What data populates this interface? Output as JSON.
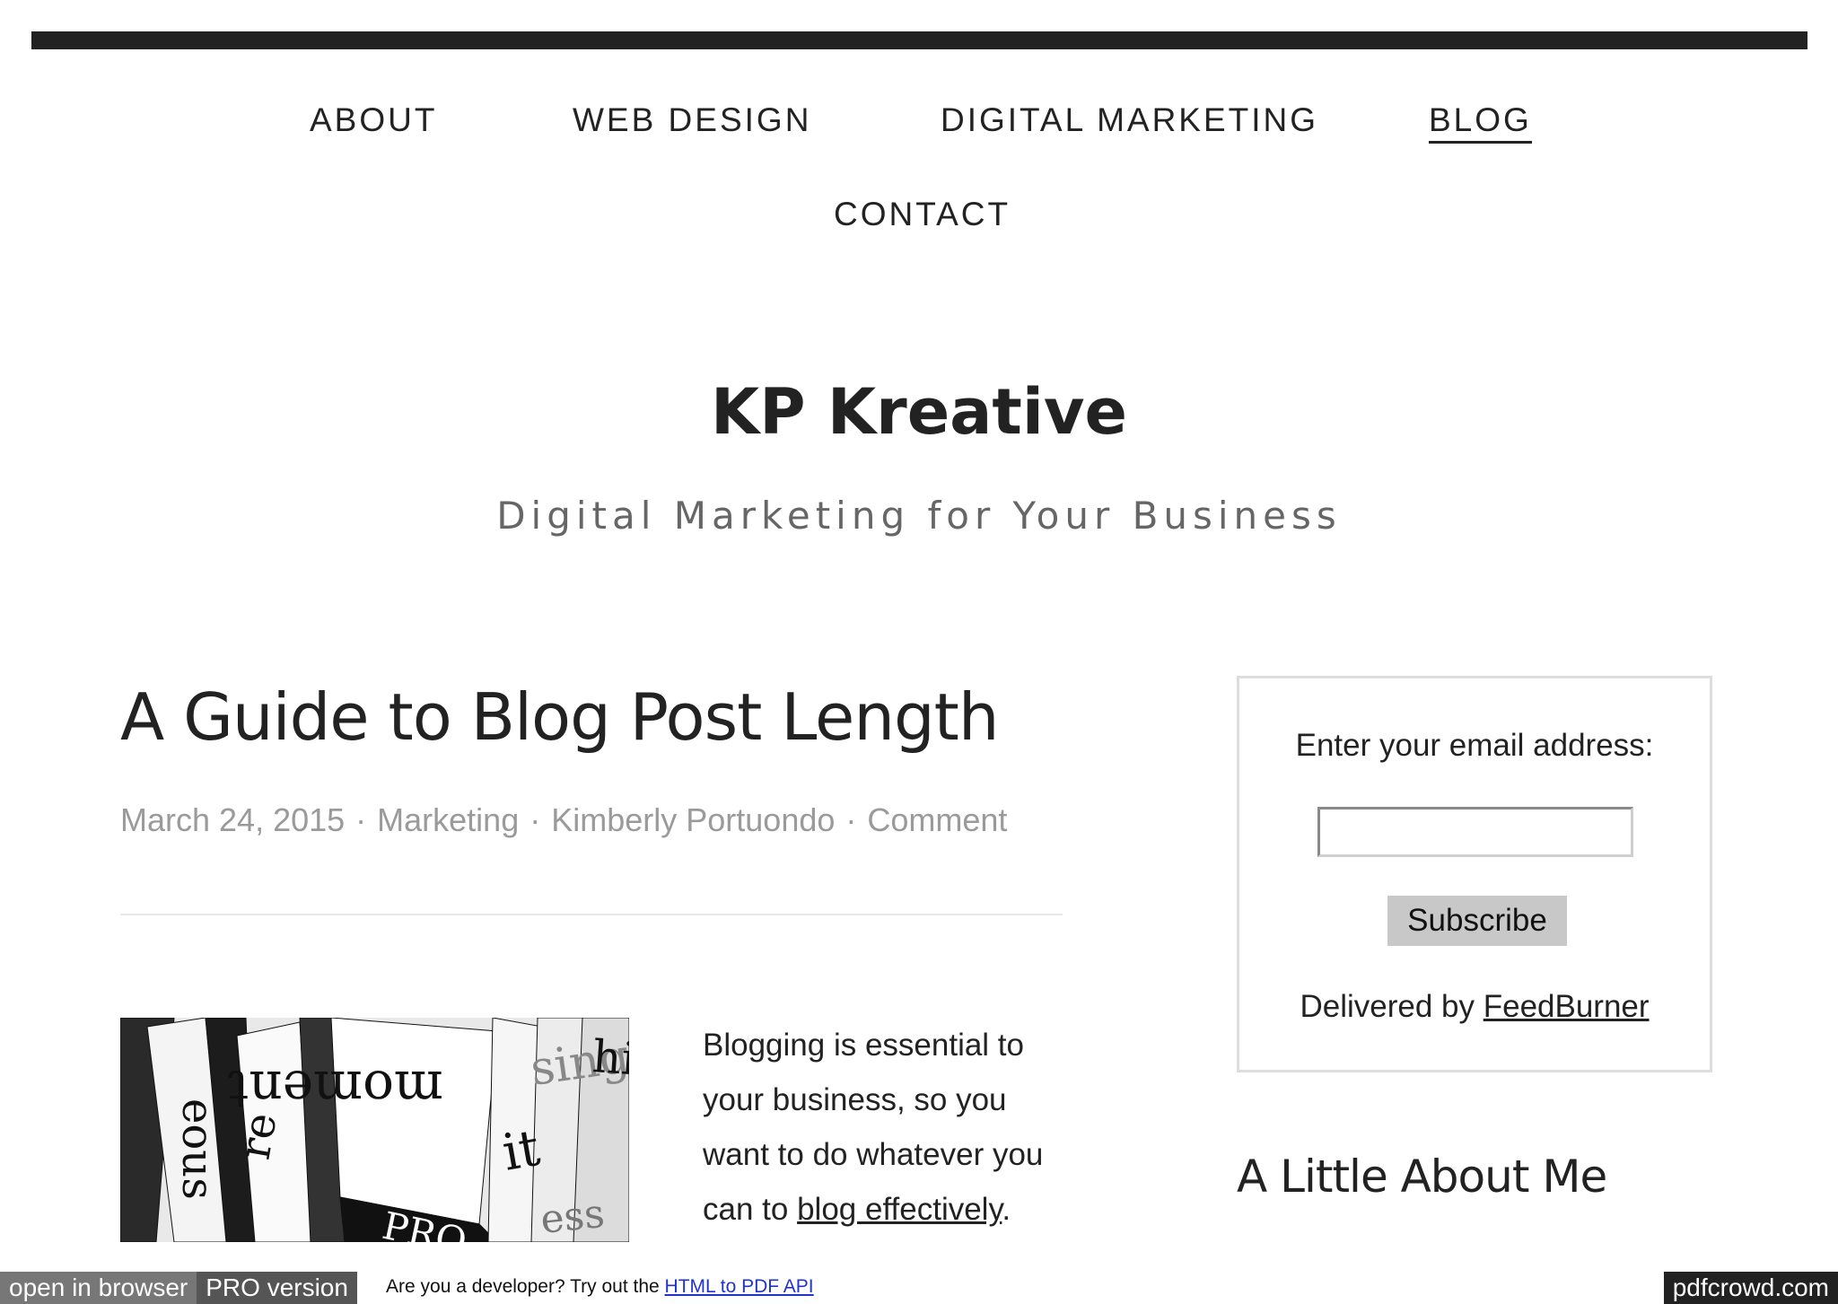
{
  "nav": {
    "about": "ABOUT",
    "web_design": "WEB DESIGN",
    "digital_marketing": "DIGITAL MARKETING",
    "blog": "BLOG",
    "contact": "CONTACT"
  },
  "site": {
    "title": "KP Kreative",
    "tagline": "Digital Marketing for Your Business"
  },
  "post": {
    "title": "A Guide to Blog Post Length",
    "date": "March 24, 2015",
    "category": "Marketing",
    "author": "Kimberly Portuondo",
    "comment": "Comment",
    "separator": "·",
    "body_text": "Blogging is essential to your business, so you want to do whatever you can to ",
    "body_link": "blog effectively",
    "body_end": "."
  },
  "image_words": [
    "moment",
    "sing",
    "it",
    "ess",
    "eous",
    "re",
    "hi",
    "PRO"
  ],
  "subscribe_widget": {
    "label": "Enter your email address:",
    "input_value": "",
    "button_label": "Subscribe",
    "delivered_prefix": "Delivered by ",
    "delivered_link": "FeedBurner"
  },
  "sidebar": {
    "heading": "A Little About Me"
  },
  "pdfcrowd": {
    "open_in_browser": "open in browser",
    "pro_version": "PRO version",
    "promo_text": "Are you a developer? Try out the ",
    "promo_link": "HTML to PDF API",
    "brand": "pdfcrowd.com"
  }
}
